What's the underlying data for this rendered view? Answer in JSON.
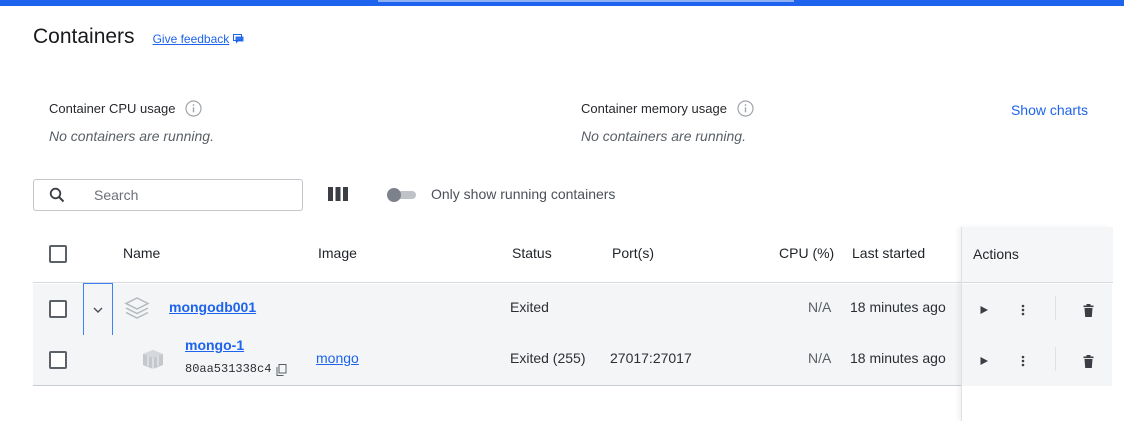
{
  "page": {
    "title": "Containers",
    "feedback_label": "Give feedback"
  },
  "usage": {
    "cpu_label": "Container CPU usage",
    "cpu_message": "No containers are running.",
    "memory_label": "Container memory usage",
    "memory_message": "No containers are running.",
    "show_charts_label": "Show charts"
  },
  "toolbar": {
    "search_placeholder": "Search",
    "only_running_label": "Only show running containers",
    "only_running_enabled": false
  },
  "table": {
    "columns": [
      "Name",
      "Image",
      "Status",
      "Port(s)",
      "CPU (%)",
      "Last started",
      "Actions"
    ],
    "rows": [
      {
        "name": "mongodb001",
        "image": "",
        "status": "Exited",
        "ports": "",
        "cpu": "N/A",
        "last_started": "18 minutes ago",
        "icon": "compose-stack-icon",
        "expanded": true
      },
      {
        "name": "mongo-1",
        "id": "80aa531338c4",
        "image": "mongo",
        "status": "Exited (255)",
        "ports": "27017:27017",
        "cpu": "N/A",
        "last_started": "18 minutes ago",
        "icon": "container-icon"
      }
    ]
  },
  "icons": {
    "search": "search-icon",
    "columns": "columns-icon",
    "info": "info-icon",
    "feedback": "chat-icon",
    "start": "play-icon",
    "more": "more-vertical-icon",
    "delete": "trash-icon",
    "copy": "copy-icon",
    "expand": "chevron-down-icon"
  },
  "colors": {
    "accent": "#1d63ed",
    "row_background": "#f4f5f6"
  }
}
